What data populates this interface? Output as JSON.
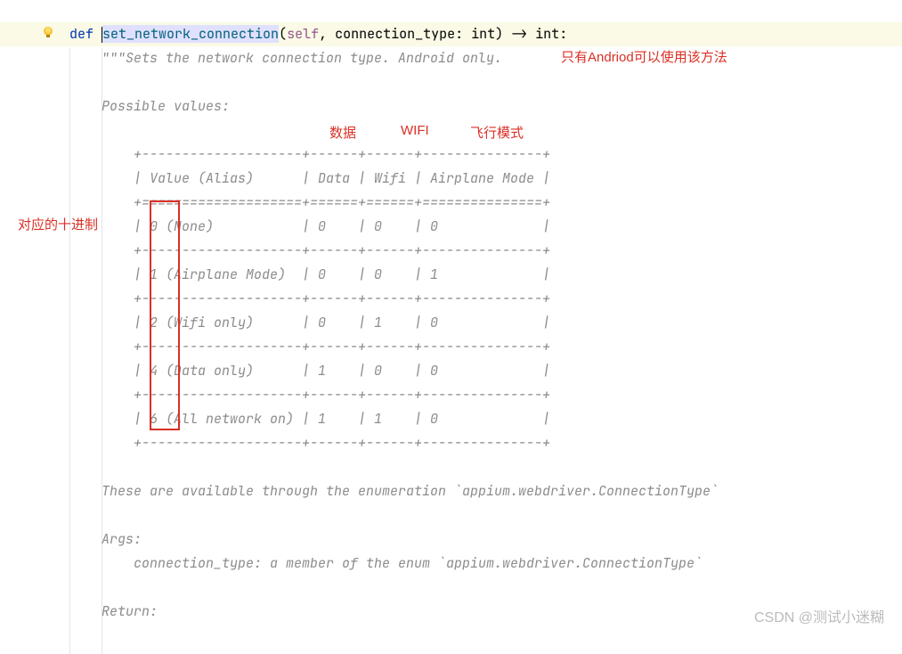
{
  "code": {
    "def_kw": "def",
    "fn_name": "set_network_connection",
    "params_open": "(",
    "param_self": "self",
    "comma1": ", ",
    "param_name": "connection_type",
    "colon1": ": ",
    "param_type": "int",
    "params_close": ")",
    "arrow": " -> ",
    "ret_type": "int",
    "end_colon": ":"
  },
  "doc": {
    "l0": "\"\"\"Sets the network connection type. Android only.",
    "l1": "",
    "l2": "Possible values:",
    "t_top": "    +--------------------+------+------+---------------+",
    "t_head": "    | Value (Alias)      | Data | Wifi | Airplane Mode |",
    "t_sep": "    +====================+======+======+===============+",
    "t_r0": "    | 0 (None)           | 0    | 0    | 0             |",
    "t_div": "    +--------------------+------+------+---------------+",
    "t_r1": "    | 1 (Airplane Mode)  | 0    | 0    | 1             |",
    "t_r2": "    | 2 (Wifi only)      | 0    | 1    | 0             |",
    "t_r3": "    | 4 (Data only)      | 1    | 0    | 0             |",
    "t_r4": "    | 6 (All network on) | 1    | 1    | 0             |",
    "l3": "These are available through the enumeration `appium.webdriver.ConnectionType`",
    "l4": "Args:",
    "l5": "    connection_type: a member of the enum `appium.webdriver.ConnectionType`",
    "l6": "Return:"
  },
  "annotations": {
    "android_only": "只有Andriod可以使用该方法",
    "col_data": "数据",
    "col_wifi": "WIFI",
    "col_airplane": "飞行模式",
    "decimal": "对应的十进制"
  },
  "watermark": "CSDN @测试小迷糊",
  "chart_data": {
    "type": "table",
    "title": "Possible values",
    "columns": [
      "Value (Alias)",
      "Data",
      "Wifi",
      "Airplane Mode"
    ],
    "rows": [
      {
        "value": 0,
        "alias": "None",
        "data": 0,
        "wifi": 0,
        "airplane_mode": 0
      },
      {
        "value": 1,
        "alias": "Airplane Mode",
        "data": 0,
        "wifi": 0,
        "airplane_mode": 1
      },
      {
        "value": 2,
        "alias": "Wifi only",
        "data": 0,
        "wifi": 1,
        "airplane_mode": 0
      },
      {
        "value": 4,
        "alias": "Data only",
        "data": 1,
        "wifi": 0,
        "airplane_mode": 0
      },
      {
        "value": 6,
        "alias": "All network on",
        "data": 1,
        "wifi": 1,
        "airplane_mode": 0
      }
    ]
  }
}
